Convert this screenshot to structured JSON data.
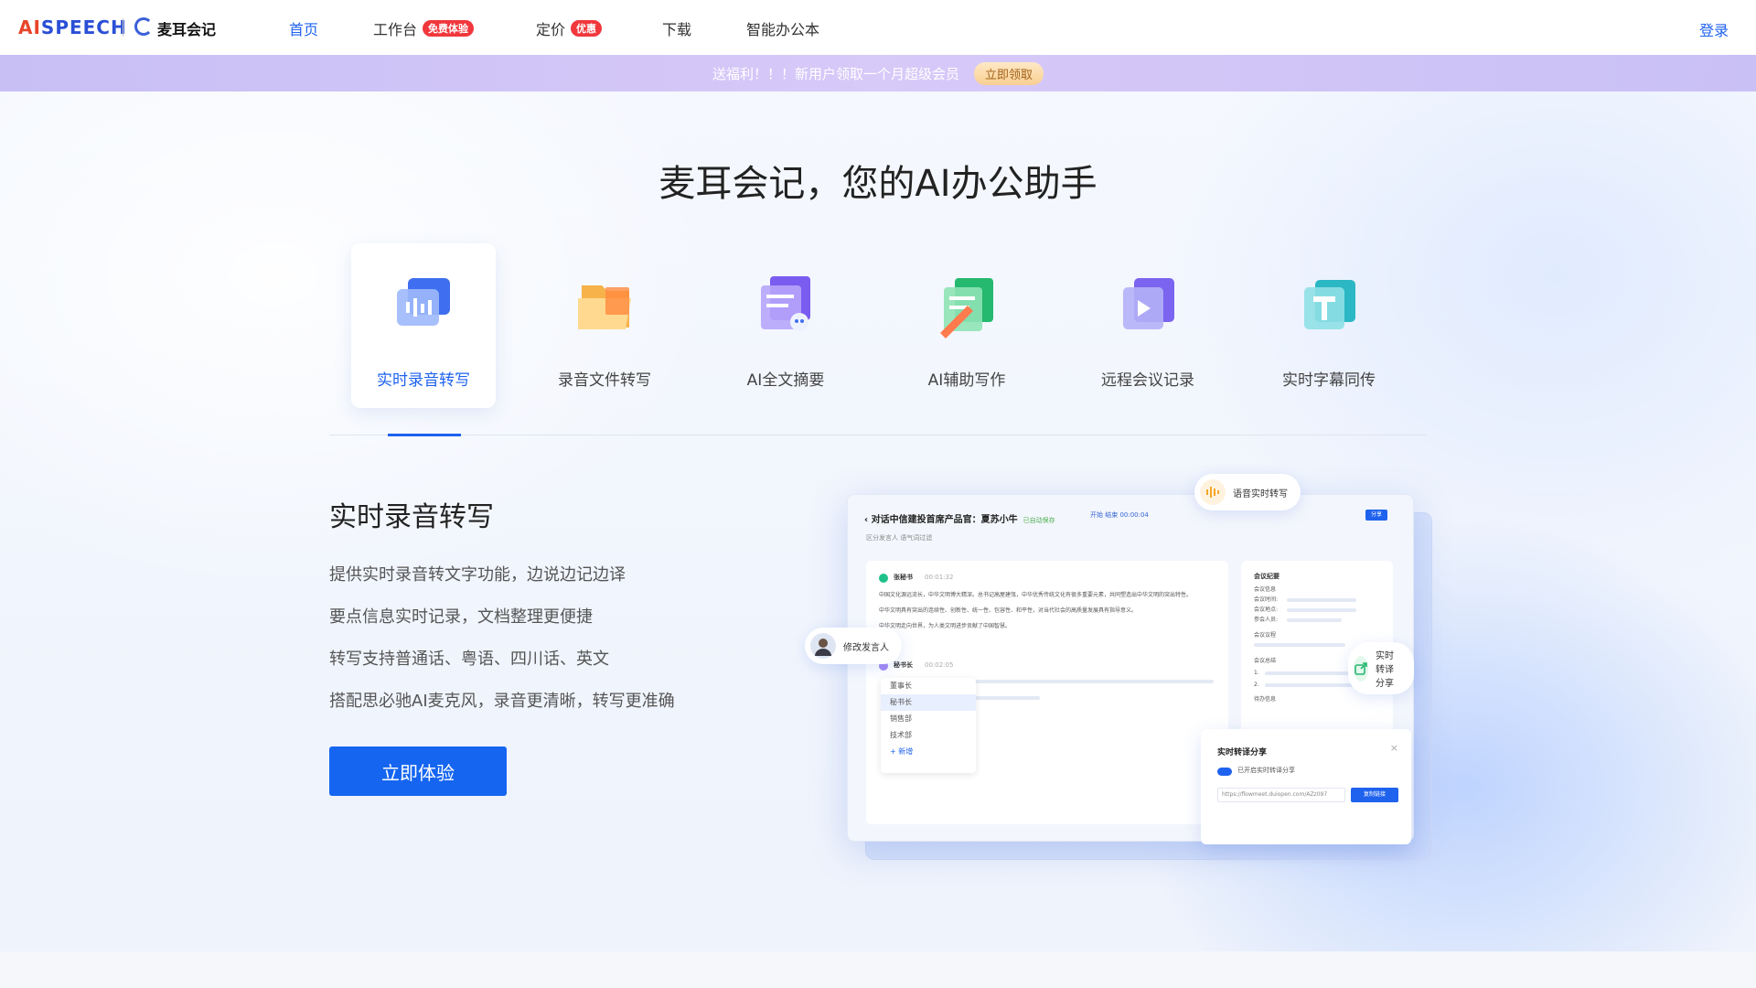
{
  "nav": {
    "logo_prefix": "AI",
    "logo_suffix": "SPEECH",
    "brand": "麦耳会记",
    "items": [
      {
        "label": "首页",
        "badge": "",
        "active": true
      },
      {
        "label": "工作台",
        "badge": "免费体验",
        "active": false
      },
      {
        "label": "定价",
        "badge": "优惠",
        "active": false
      },
      {
        "label": "下载",
        "badge": "",
        "active": false
      },
      {
        "label": "智能办公本",
        "badge": "",
        "active": false
      }
    ],
    "login": "登录"
  },
  "promo": {
    "text": "送福利！！！新用户领取一个月超级会员",
    "button": "立即领取"
  },
  "hero": {
    "title": "麦耳会记，您的AI办公助手"
  },
  "tabs": [
    {
      "label": "实时录音转写",
      "icon": "mic-wave-icon",
      "active": true
    },
    {
      "label": "录音文件转写",
      "icon": "folder-icon",
      "active": false
    },
    {
      "label": "AI全文摘要",
      "icon": "robot-summary-icon",
      "active": false
    },
    {
      "label": "AI辅助写作",
      "icon": "pen-write-icon",
      "active": false
    },
    {
      "label": "远程会议记录",
      "icon": "video-play-icon",
      "active": false
    },
    {
      "label": "实时字幕同传",
      "icon": "subtitle-t-icon",
      "active": false
    }
  ],
  "section": {
    "title": "实时录音转写",
    "features": [
      "提供实时录音转文字功能，边说边记边译",
      "要点信息实时记录，文档整理更便捷",
      "转写支持普通话、粤语、四川话、英文",
      "搭配思必驰AI麦克风，录音更清晰，转写更准确"
    ],
    "cta": "立即体验"
  },
  "mockup": {
    "title": "对话中信建投首席产品官：夏苏小牛",
    "saved": "已自动保存",
    "controls": "开始   结束   00:00:04",
    "share": "分享",
    "sub": "区分发言人        语气词过滤",
    "speaker1": "张秘书",
    "speaker1_time": "00:01:32",
    "transcript": [
      "中国文化源远流长，中华文明博大精深。总书记高屋建瓴，中华优秀传统文化有很多重要元素，共同塑造出中华文明的突出特性。",
      "中华文明具有突出的连续性、创新性、统一性、包容性、和平性，对当代社会的高质量发展具有指导意义。",
      "中华文明走向世界，为人类文明进步贡献了中国智慧。"
    ],
    "speaker2": "秘书长",
    "speaker2_time": "00:02:05",
    "menu": [
      "董事长",
      "秘书长",
      "销售部",
      "技术部",
      "+ 新增"
    ],
    "summary_title": "会议纪要",
    "summary_labels": [
      "会议信息",
      "会议时间:",
      "会议地点:",
      "参会人员:",
      "会议议程",
      "会议总结",
      "1.",
      "2.",
      "待办信息"
    ],
    "chip_voice": "语音实时转写",
    "chip_edit": "修改发言人",
    "chip_share": "实时转译分享",
    "share_title": "实时转译分享",
    "share_toggle": "已开启实时转译分享",
    "share_url": "https://flowmeet.duiopen.com/AZz097",
    "share_copy": "复制链接"
  },
  "colors": {
    "accent": "#1f62ee",
    "badge": "#f0373c",
    "promo_bg": "#cfc5f6"
  }
}
